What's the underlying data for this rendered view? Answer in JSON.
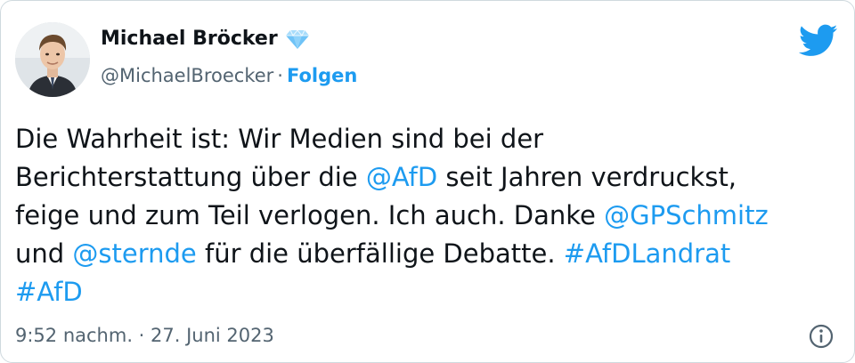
{
  "author": {
    "display_name": "Michael Bröcker",
    "handle": "@MichaelBroecker",
    "separator": "·",
    "follow_label": "Folgen",
    "verified_icon": "diamond-verified-icon"
  },
  "tweet": {
    "line1": {
      "text": "Die Wahrheit ist: Wir Medien sind bei der"
    },
    "line2": {
      "before": "Berichterstattung über die ",
      "mention": "@AfD",
      "after": " seit Jahren verdruckst,"
    },
    "line3": {
      "before": "feige und zum Teil verlogen. Ich auch. Danke ",
      "mention": "@GPSchmitz"
    },
    "line4": {
      "before": "und ",
      "mention": "@sternde",
      "middle": " für die überfällige Debatte. ",
      "hashtag": "#AfDLandrat"
    },
    "line5": {
      "hashtag": "#AfD"
    }
  },
  "meta": {
    "time": "9:52 nachm.",
    "separator": " · ",
    "date": "27. Juni 2023"
  },
  "icons": {
    "brand": "twitter-bird-icon",
    "info": "info-icon"
  },
  "colors": {
    "link": "#1d9bf0",
    "text": "#0f1419",
    "secondary": "#536471",
    "border": "#cfd9de"
  }
}
